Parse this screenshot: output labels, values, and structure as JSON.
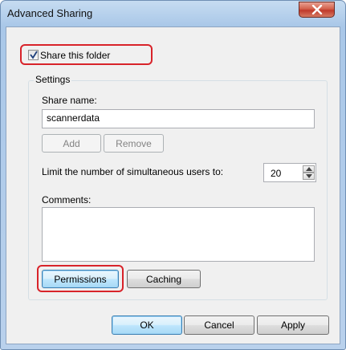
{
  "window": {
    "title": "Advanced Sharing"
  },
  "share_checkbox": {
    "label": "Share this folder",
    "checked": true
  },
  "settings": {
    "group_label": "Settings",
    "share_name_label": "Share name:",
    "share_name_value": "scannerdata",
    "add_label": "Add",
    "remove_label": "Remove",
    "limit_label": "Limit the number of simultaneous users to:",
    "limit_value": "20",
    "comments_label": "Comments:",
    "comments_value": "",
    "permissions_label": "Permissions",
    "caching_label": "Caching"
  },
  "footer": {
    "ok_label": "OK",
    "cancel_label": "Cancel",
    "apply_label": "Apply"
  },
  "colors": {
    "highlight": "#d8232a",
    "close_button": "#c0392b"
  }
}
